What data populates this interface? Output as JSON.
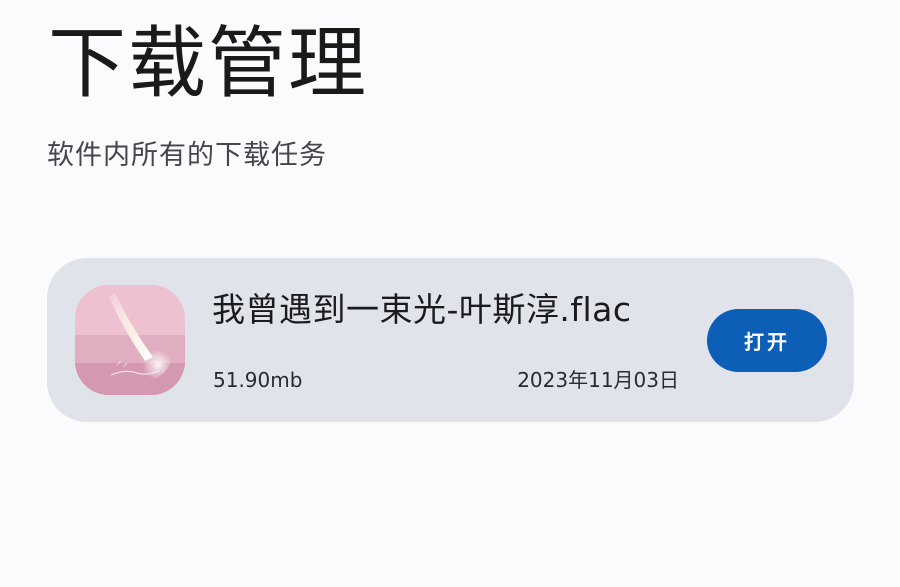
{
  "header": {
    "title": "下载管理",
    "subtitle": "软件内所有的下载任务"
  },
  "downloads": [
    {
      "file_name": "我曾遇到一束光-叶斯淳.flac",
      "size": "51.90mb",
      "date": "2023年11月03日",
      "action_label": "打开",
      "thumbnail_icon": "album-cover-thumbnail",
      "accent_color": "#0d5eb7"
    }
  ],
  "colors": {
    "background": "#fbfafd",
    "card_background": "#e1e3ea",
    "button_background": "#0d5eb7",
    "button_text": "#ffffff"
  }
}
